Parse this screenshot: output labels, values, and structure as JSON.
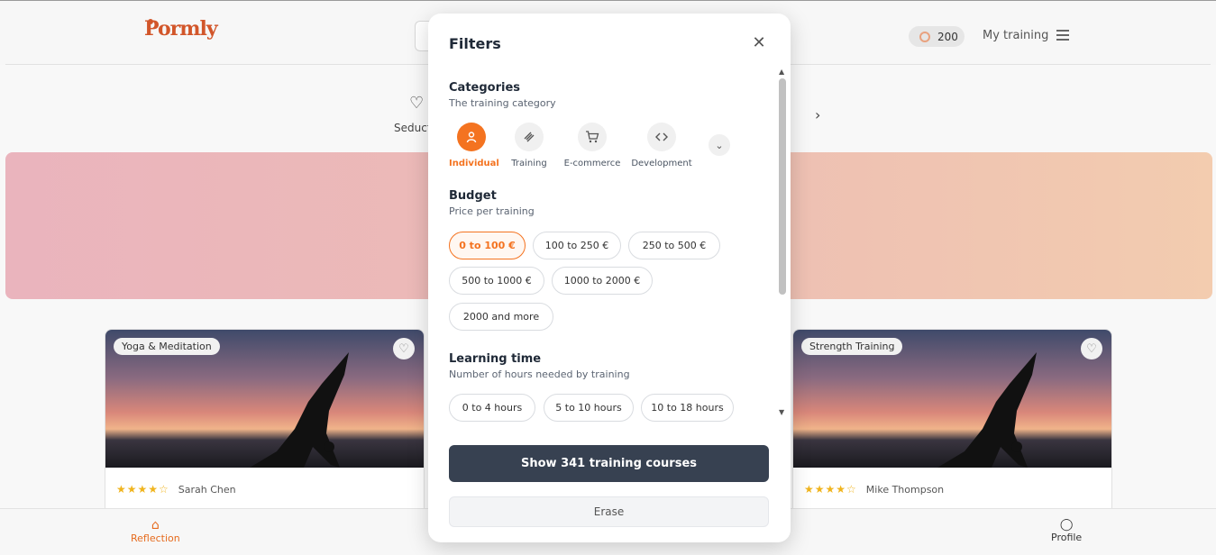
{
  "app": {
    "logo_text": "Pormly",
    "points": "200",
    "my_training": "My training"
  },
  "categories_bar": {
    "visible_label": "Seducti"
  },
  "cards": [
    {
      "tag": "Yoga & Meditation",
      "stars": 4,
      "author": "Sarah Chen"
    },
    {
      "tag": "Strength Training",
      "stars": 4,
      "author": "Mike Thompson"
    }
  ],
  "bottom_nav": {
    "reflection": "Reflection",
    "profile": "Profile"
  },
  "modal": {
    "title": "Filters",
    "categories": {
      "title": "Categories",
      "subtitle": "The training category",
      "items": [
        {
          "label": "Individual",
          "icon": "person-icon",
          "active": true
        },
        {
          "label": "Training",
          "icon": "dumbbell-icon",
          "active": false
        },
        {
          "label": "E-commerce",
          "icon": "cart-icon",
          "active": false
        },
        {
          "label": "Development",
          "icon": "code-icon",
          "active": false
        }
      ]
    },
    "budget": {
      "title": "Budget",
      "subtitle": "Price per training",
      "options": [
        "0 to 100 €",
        "100 to 250 €",
        "250 to 500 €",
        "500 to 1000 €",
        "1000 to 2000 €",
        "2000 and more"
      ],
      "selected": "0 to 100 €"
    },
    "learning_time": {
      "title": "Learning time",
      "subtitle": "Number of hours needed by training",
      "options": [
        "0 to 4 hours",
        "5 to 10 hours",
        "10 to 18 hours"
      ]
    },
    "show_button": "Show 341  training courses",
    "erase_button": "Erase"
  },
  "colors": {
    "accent": "#f47320",
    "primary_button": "#374151"
  }
}
